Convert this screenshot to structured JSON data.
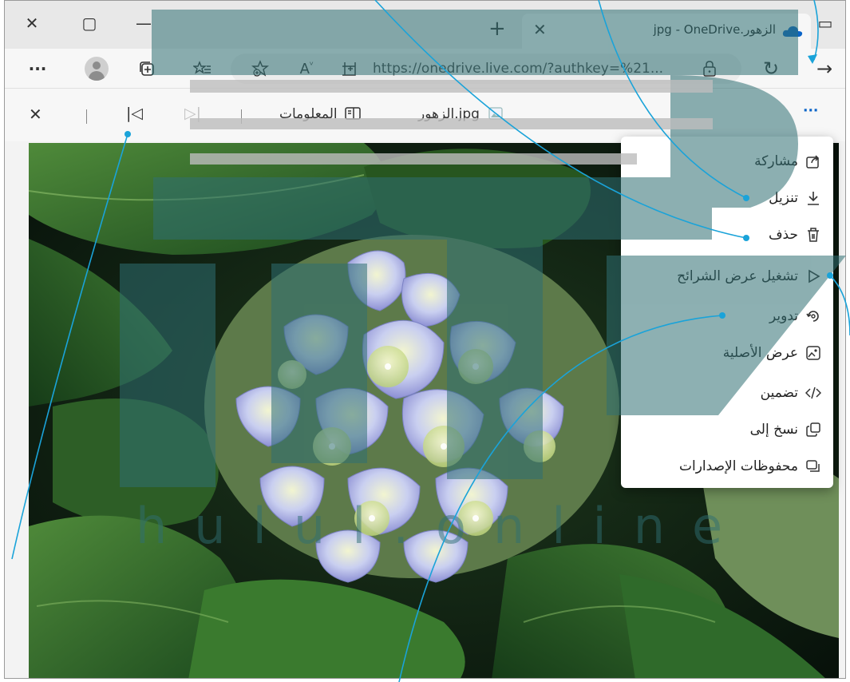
{
  "window": {
    "close_glyph": "✕",
    "restore_glyph": "▢",
    "minimize_glyph": "—",
    "tab_actions_glyph": "▭"
  },
  "tab": {
    "title": "jpg - OneDrive.الزهور",
    "close_glyph": "✕",
    "new_tab_glyph": "+"
  },
  "navbar": {
    "menu_glyph": "···",
    "url": "https://onedrive.live.com/?authkey=%21...",
    "refresh_glyph": "↻",
    "forward_glyph": "→"
  },
  "viewer": {
    "close_glyph": "✕",
    "first_glyph": "|◁",
    "prev_glyph": "▷|",
    "info_label": "المعلومات",
    "filename": "الزهور.jpg",
    "more_glyph": "···"
  },
  "menu": {
    "items": [
      {
        "label": "مشاركة",
        "icon": "share-icon"
      },
      {
        "label": "تنزيل",
        "icon": "download-icon"
      },
      {
        "label": "حذف",
        "icon": "trash-icon"
      },
      {
        "label": "تشغيل عرض الشرائح",
        "icon": "play-icon"
      },
      {
        "label": "تدوير",
        "icon": "rotate-icon"
      },
      {
        "label": "عرض الأصلية",
        "icon": "image-icon"
      },
      {
        "label": "تضمين",
        "icon": "embed-icon"
      },
      {
        "label": "نسخ إلى",
        "icon": "copy-icon"
      },
      {
        "label": "محفوظات الإصدارات",
        "icon": "versions-icon"
      }
    ]
  },
  "watermark": {
    "text": "hulul.online"
  },
  "colors": {
    "callout_line": "#1aa3d9",
    "watermark_teal": "#2f6f73",
    "onedrive_blue": "#0a64c8"
  }
}
